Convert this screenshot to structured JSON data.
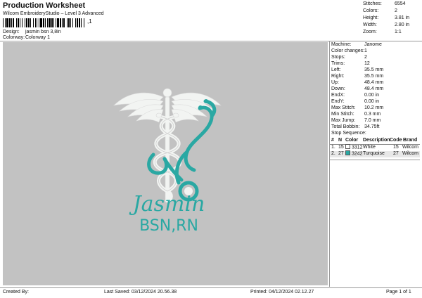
{
  "header": {
    "title": "Production Worksheet",
    "software": "Wilcom EmbroideryStudio – Level 3 Advanced",
    "barcode_suffix": ",1",
    "design_label": "Design:",
    "design_value": "jasmin bsn 3,8in",
    "colorway_label": "Colorway:",
    "colorway_value": "Colorway 1"
  },
  "stats": {
    "stitches_label": "Stitches:",
    "stitches_value": "6554",
    "colors_label": "Colors:",
    "colors_value": "2",
    "height_label": "Height:",
    "height_value": "3.81 in",
    "width_label": "Width:",
    "width_value": "2.80 in",
    "zoom_label": "Zoom:",
    "zoom_value": "1:1"
  },
  "design": {
    "script_text": "Jasmin",
    "credentials_text": "BSN,RN",
    "white_color": "#f2f4f2",
    "teal_color": "#2aa8a3",
    "background_color": "#c2c2c2"
  },
  "info": {
    "machine_label": "Machine:",
    "machine_value": "Janome",
    "color_changes_label": "Color changes:",
    "color_changes_value": "1",
    "stops_label": "Stops:",
    "stops_value": "2",
    "trims_label": "Trims:",
    "trims_value": "12",
    "left_label": "Left:",
    "left_value": "35.5 mm",
    "right_label": "Right:",
    "right_value": "35.5 mm",
    "up_label": "Up:",
    "up_value": "48.4 mm",
    "down_label": "Down:",
    "down_value": "48.4 mm",
    "endx_label": "EndX:",
    "endx_value": "0.00 in",
    "endy_label": "EndY:",
    "endy_value": "0.00 in",
    "max_stitch_label": "Max Stitch:",
    "max_stitch_value": "10.2 mm",
    "min_stitch_label": "Min Stitch:",
    "min_stitch_value": "0.3 mm",
    "max_jump_label": "Max Jump:",
    "max_jump_value": "7.0 mm",
    "total_bobbin_label": "Total Bobbin:",
    "total_bobbin_value": "34.75ft"
  },
  "stop_sequence": {
    "title": "Stop Sequence:",
    "headers": [
      "#",
      "N",
      "Color",
      "Description",
      "Code",
      "Brand"
    ],
    "rows": [
      {
        "num": "1.",
        "n": "15",
        "color_hex": "#ffffff",
        "color_code": "3312",
        "description": "White",
        "code": "15",
        "brand": "Wilcom"
      },
      {
        "num": "2.",
        "n": "27",
        "color_hex": "#2aa8a3",
        "color_code": "3242",
        "description": "Turquoise",
        "code": "27",
        "brand": "Wilcom"
      }
    ]
  },
  "footer": {
    "created_by": "Created By:",
    "last_saved": "Last Saved: 03/12/2024 20.56.38",
    "printed": "Printed: 04/12/2024 02.12.27",
    "page": "Page 1 of 1"
  }
}
